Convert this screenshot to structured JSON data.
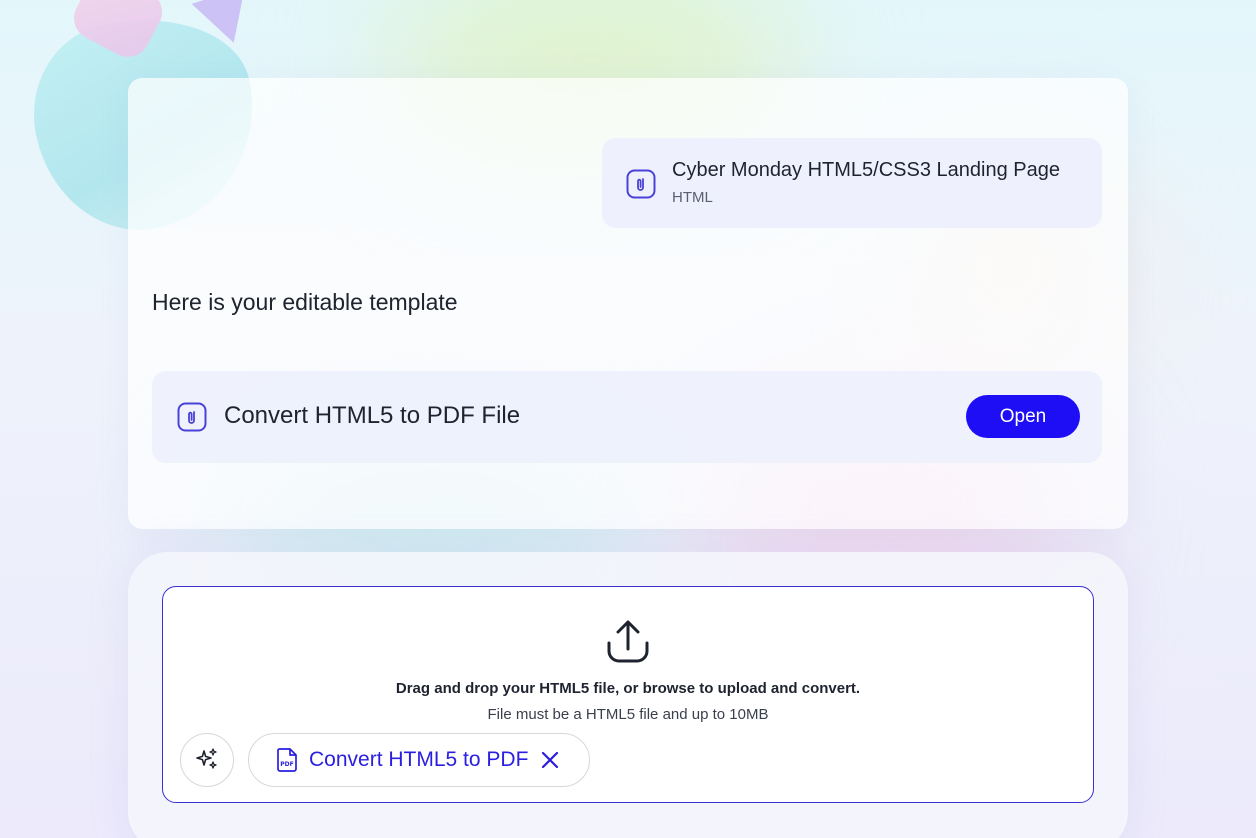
{
  "file_chip": {
    "title": "Cyber Monday HTML5/CSS3 Landing Page",
    "subtitle": "HTML",
    "icon": "attachment-icon"
  },
  "message": {
    "text": "Here is your editable  template"
  },
  "result": {
    "title": "Convert HTML5 to PDF File",
    "icon": "attachment-icon",
    "open_label": "Open"
  },
  "upload": {
    "icon": "upload-icon",
    "primary_text": "Drag and drop your HTML5 file, or browse to upload  and convert.",
    "secondary_text": "File must be a HTML5 file and up to 10MB",
    "magic_icon": "sparkles-icon",
    "tool_label": "Convert HTML5 to PDF",
    "tool_icon": "pdf-file-icon",
    "remove_icon": "close-icon"
  },
  "colors": {
    "accent": "#1e0ef5",
    "accent_text": "#2a1ee0",
    "dropzone_border": "#3b2fd6"
  }
}
